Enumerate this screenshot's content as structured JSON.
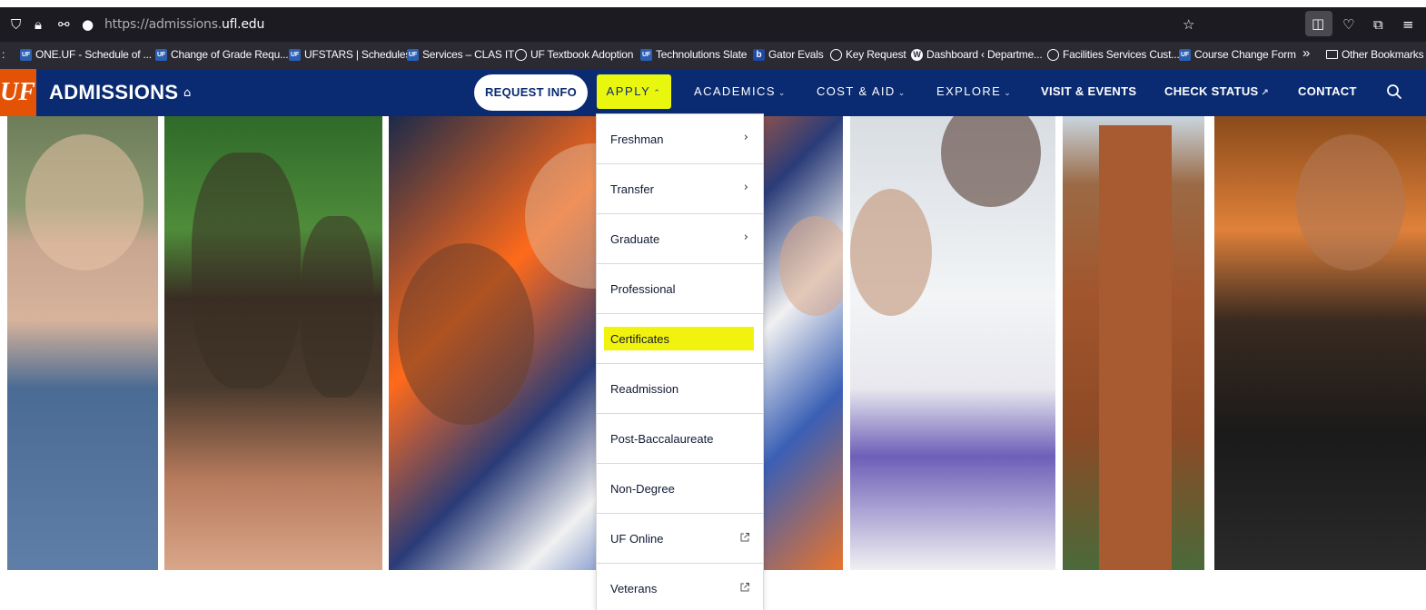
{
  "browser": {
    "url_prefix": "https://admissions.",
    "url_domain": "ufl.edu",
    "bookmarks": [
      {
        "label": "ONE.UF - Schedule of ...",
        "icon": "uf-favicon"
      },
      {
        "label": "Change of Grade Requ...",
        "icon": "uf-favicon"
      },
      {
        "label": "UFSTARS | Schedules",
        "icon": "uf-favicon"
      },
      {
        "label": "Services – CLAS IT",
        "icon": "uf-favicon"
      },
      {
        "label": "UF Textbook Adoption",
        "icon": "globe-icon"
      },
      {
        "label": "Technolutions Slate",
        "icon": "uf-favicon"
      },
      {
        "label": "Gator Evals",
        "icon": "b-favicon"
      },
      {
        "label": "Key Request",
        "icon": "globe-icon"
      },
      {
        "label": "Dashboard ‹ Departme...",
        "icon": "wordpress-icon"
      },
      {
        "label": "Facilities Services Cust...",
        "icon": "globe-icon"
      },
      {
        "label": "Course Change Form",
        "icon": "uf-favicon"
      }
    ],
    "overflow_label": "»",
    "other_bookmarks": "Other Bookmarks"
  },
  "site": {
    "logo": "UF",
    "title": "ADMISSIONS",
    "request_info": "REQUEST INFO",
    "nav": {
      "apply": "APPLY",
      "academics": "ACADEMICS",
      "cost_aid": "COST & AID",
      "explore": "EXPLORE",
      "visit_events": "VISIT & EVENTS",
      "check_status": "CHECK STATUS",
      "contact": "CONTACT"
    }
  },
  "apply_menu": [
    {
      "label": "Freshman",
      "trailing": "chevron"
    },
    {
      "label": "Transfer",
      "trailing": "chevron"
    },
    {
      "label": "Graduate",
      "trailing": "chevron"
    },
    {
      "label": "Professional",
      "trailing": "none"
    },
    {
      "label": "Certificates",
      "trailing": "none",
      "highlighted": true
    },
    {
      "label": "Readmission",
      "trailing": "none"
    },
    {
      "label": "Post-Baccalaureate",
      "trailing": "none"
    },
    {
      "label": "Non-Degree",
      "trailing": "none"
    },
    {
      "label": "UF Online",
      "trailing": "external"
    },
    {
      "label": "Veterans",
      "trailing": "external"
    }
  ],
  "colors": {
    "nav_blue": "#0a2b72",
    "uf_orange": "#e35205",
    "highlight_yellow": "#f2f20f"
  }
}
